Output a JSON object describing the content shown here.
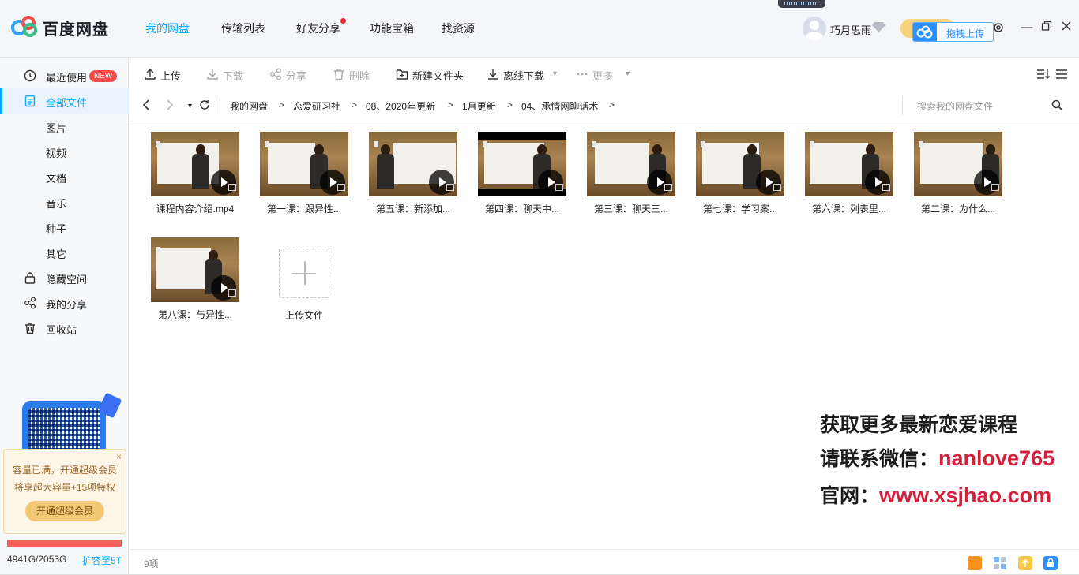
{
  "app": {
    "logo_text": "百度网盘"
  },
  "nav": [
    {
      "label": "我的网盘",
      "active": true
    },
    {
      "label": "传输列表"
    },
    {
      "label": "好友分享",
      "dot": true
    },
    {
      "label": "功能宝箱"
    },
    {
      "label": "找资源"
    }
  ],
  "user": {
    "name": "巧月思雨"
  },
  "drag_upload": {
    "label": "拖拽上传"
  },
  "sidebar": {
    "items": [
      {
        "label": "最近使用",
        "badge": "NEW"
      },
      {
        "label": "全部文件",
        "active": true
      },
      {
        "label": "图片"
      },
      {
        "label": "视频"
      },
      {
        "label": "文档"
      },
      {
        "label": "音乐"
      },
      {
        "label": "种子"
      },
      {
        "label": "其它"
      },
      {
        "label": "隐藏空间"
      },
      {
        "label": "我的分享"
      },
      {
        "label": "回收站"
      }
    ],
    "promo": {
      "line1": "容量已满，开通超级会员",
      "line2": "将享超大容量+15项特权",
      "button": "开通超级会员",
      "close": "×"
    },
    "quota": {
      "used": "4941G/2053G",
      "expand": "扩容至5T"
    }
  },
  "toolbar": {
    "upload": "上传",
    "download": "下载",
    "share": "分享",
    "delete": "删除",
    "new_folder": "新建文件夹",
    "offline": "离线下载",
    "more": "更多"
  },
  "path": {
    "crumbs": [
      "我的网盘",
      "恋爱研习社",
      "08、2020年更新",
      "1月更新",
      "04、承情网聊话术"
    ],
    "separator": ">",
    "search_placeholder": "搜索我的网盘文件"
  },
  "files": [
    {
      "name": "课程内容介绍.mp4"
    },
    {
      "name": "第一课：跟异性..."
    },
    {
      "name": "第五课：新添加..."
    },
    {
      "name": "第四课：聊天中..."
    },
    {
      "name": "第三课：聊天三..."
    },
    {
      "name": "第七课：学习案..."
    },
    {
      "name": "第六课：列表里..."
    },
    {
      "name": "第二课：为什么..."
    },
    {
      "name": "第八课：与异性..."
    }
  ],
  "upload_tile": {
    "label": "上传文件"
  },
  "watermark": {
    "line1": "获取更多最新恋爱课程",
    "line2_prefix": "请联系微信：",
    "line2_value": "nanlove765",
    "line3_prefix": "官网：",
    "line3_value": "www.xsjhao.com"
  },
  "status": {
    "count": "9项"
  },
  "colors": {
    "accent": "#09aaff",
    "danger": "#f54b4b",
    "gold": "#f3c874"
  }
}
